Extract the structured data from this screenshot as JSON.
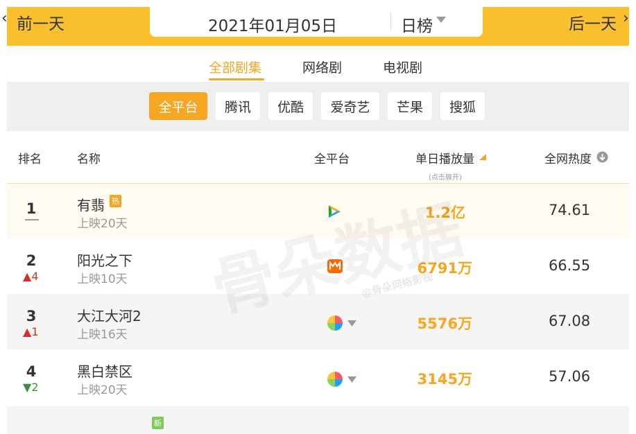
{
  "nav": {
    "prev": "前一天",
    "next": "后一天",
    "date": "2021年01月05日",
    "period": "日榜"
  },
  "tabs": [
    {
      "label": "全部剧集",
      "active": true
    },
    {
      "label": "网络剧",
      "active": false
    },
    {
      "label": "电视剧",
      "active": false
    }
  ],
  "platforms": [
    {
      "label": "全平台",
      "active": true
    },
    {
      "label": "腾讯",
      "active": false
    },
    {
      "label": "优酷",
      "active": false
    },
    {
      "label": "爱奇艺",
      "active": false
    },
    {
      "label": "芒果",
      "active": false
    },
    {
      "label": "搜狐",
      "active": false
    }
  ],
  "columns": {
    "rank": "排名",
    "name": "名称",
    "platform": "全平台",
    "plays": "单日播放量",
    "plays_note": "(点击展开)",
    "heat": "全网热度"
  },
  "rows": [
    {
      "rank": "1",
      "change": "",
      "title": "有翡",
      "badge": "热",
      "sub": "上映20天",
      "platform_icon": "tencent-video-icon",
      "plays": "1.2亿",
      "heat": "74.61"
    },
    {
      "rank": "2",
      "change": "4",
      "title": "阳光之下",
      "badge": "",
      "sub": "上映10天",
      "platform_icon": "mango-tv-icon",
      "plays": "6791万",
      "heat": "66.55"
    },
    {
      "rank": "3",
      "change": "1",
      "title": "大江大河2",
      "badge": "",
      "sub": "上映16天",
      "platform_icon": "multi-platform-icon",
      "plays": "5576万",
      "heat": "67.08"
    },
    {
      "rank": "4",
      "change": "2",
      "title": "黑白禁区",
      "badge": "",
      "sub": "上映20天",
      "platform_icon": "multi-platform-icon",
      "plays": "3145万",
      "heat": "57.06"
    }
  ],
  "row5_badge": "新",
  "watermark": {
    "brand": "骨朵数据",
    "handle": "@骨朵网络影视"
  },
  "colors": {
    "accent": "#F5A623",
    "topbar": "#FBC02D",
    "up": "#D32F2F",
    "down": "#388E3C"
  }
}
